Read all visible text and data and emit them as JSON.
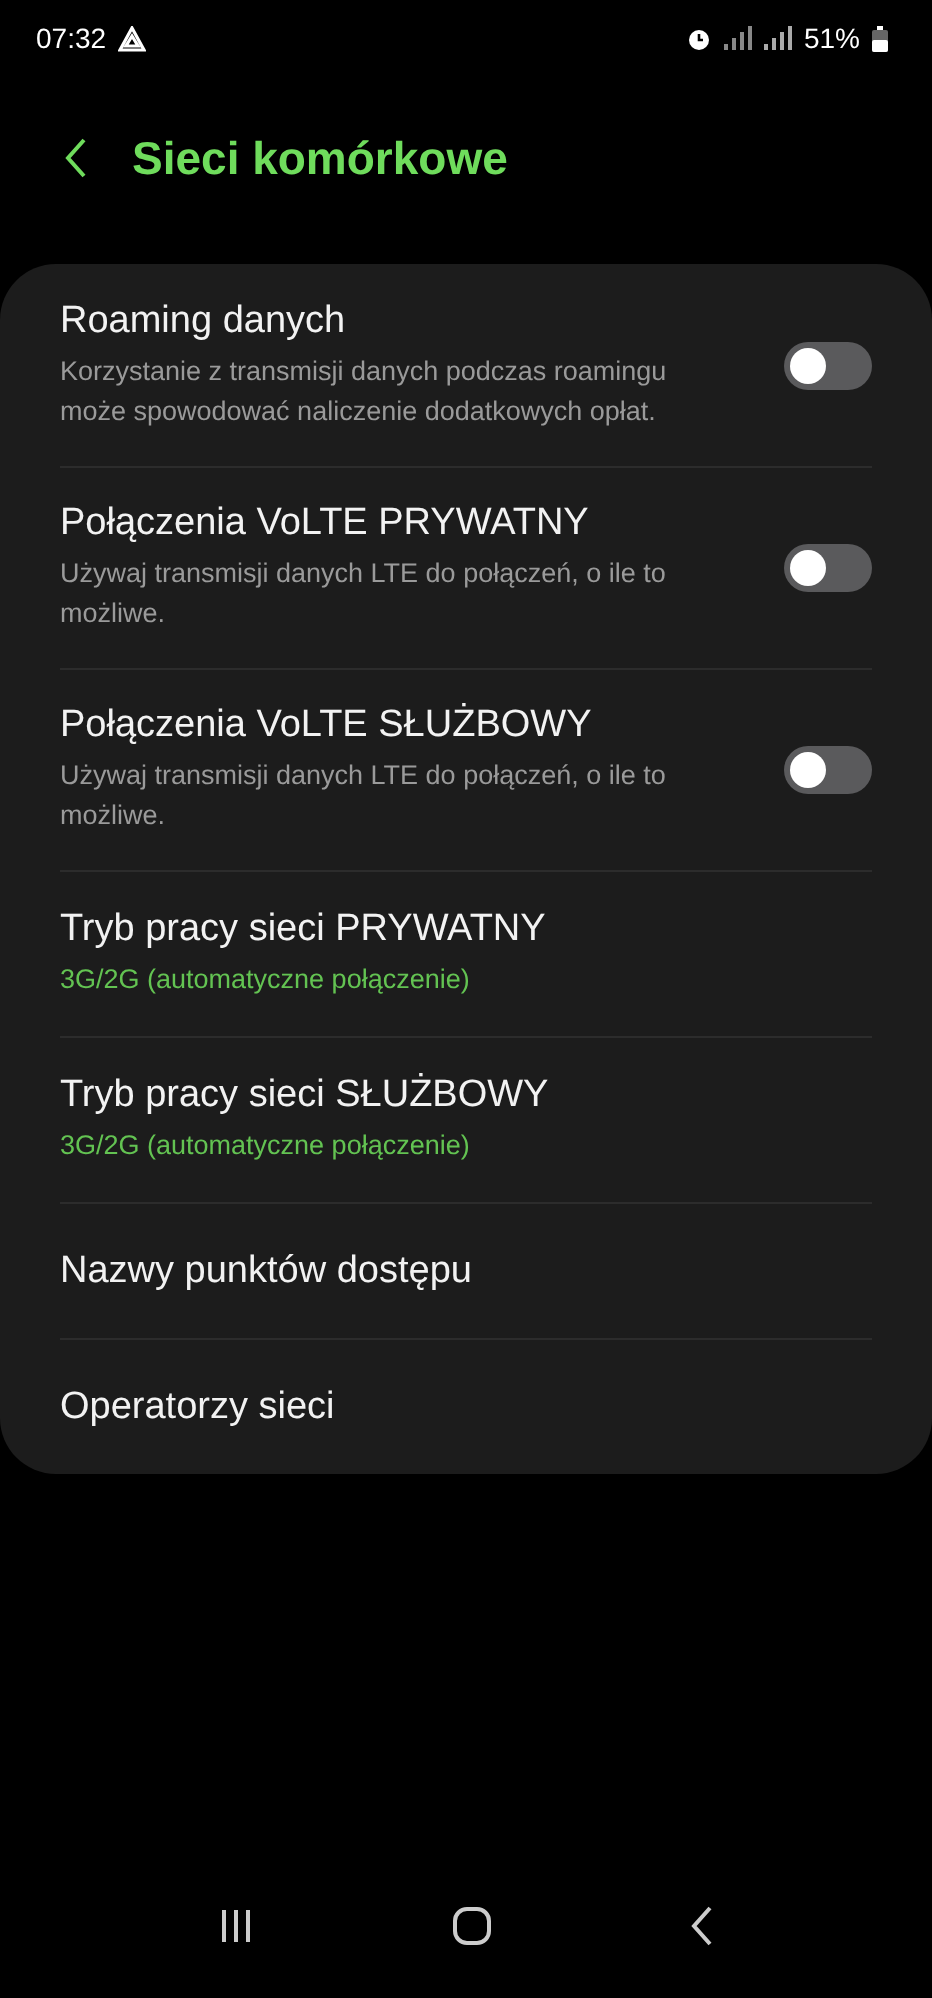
{
  "status_bar": {
    "time": "07:32",
    "battery": "51%"
  },
  "header": {
    "title": "Sieci komórkowe"
  },
  "items": [
    {
      "kind": "toggle",
      "title": "Roaming danych",
      "description": "Korzystanie z transmisji danych podczas roamingu może spowodować naliczenie dodatkowych opłat.",
      "on": false
    },
    {
      "kind": "toggle",
      "title": "Połączenia VoLTE PRYWATNY",
      "description": "Używaj transmisji danych LTE do połączeń, o ile to możliwe.",
      "on": false
    },
    {
      "kind": "toggle",
      "title": "Połączenia VoLTE SŁUŻBOWY",
      "description": "Używaj transmisji danych LTE do połączeń, o ile to możliwe.",
      "on": false
    },
    {
      "kind": "value",
      "title": "Tryb pracy sieci PRYWATNY",
      "value": "3G/2G (automatyczne połączenie)"
    },
    {
      "kind": "value",
      "title": "Tryb pracy sieci SŁUŻBOWY",
      "value": "3G/2G (automatyczne połączenie)"
    },
    {
      "kind": "link",
      "title": "Nazwy punktów dostępu"
    },
    {
      "kind": "link",
      "title": "Operatorzy sieci"
    }
  ]
}
